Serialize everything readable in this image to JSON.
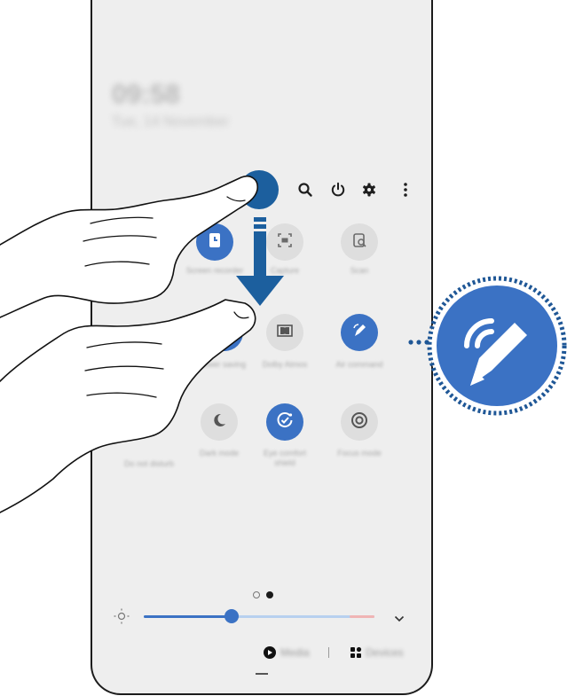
{
  "status": {
    "time": "09:58",
    "date": "Tue, 14 November"
  },
  "toolbar": {
    "icons": [
      "search-icon",
      "power-icon",
      "gear-icon",
      "more-vertical-icon"
    ]
  },
  "tiles": [
    {
      "name": "tile-screen-recorder",
      "icon": "screen-recorder-icon",
      "label": "Screen recorder",
      "state": "on"
    },
    {
      "name": "tile-video-capture",
      "icon": "capture-icon",
      "label": "Capture",
      "state": "off"
    },
    {
      "name": "tile-scan",
      "icon": "scan-icon",
      "label": "Scan",
      "state": "off"
    },
    {
      "name": "tile-power-saving",
      "icon": "power-saving-icon",
      "label": "Power saving",
      "state": "on"
    },
    {
      "name": "tile-dolby-atmos",
      "icon": "dolby-icon",
      "label": "Dolby Atmos",
      "state": "off"
    },
    {
      "name": "tile-air-command",
      "icon": "pen-icon",
      "label": "Air command",
      "state": "on"
    },
    {
      "name": "tile-dnd",
      "icon": "do-not-disturb-icon",
      "label": "Do not disturb",
      "state": "off"
    },
    {
      "name": "tile-dark-mode",
      "icon": "moon-icon",
      "label": "Dark mode",
      "state": "off"
    },
    {
      "name": "tile-eye-comfort",
      "icon": "check-clock-icon",
      "label": "Eye comfort shield",
      "state": "on"
    },
    {
      "name": "tile-focus-mode",
      "icon": "focus-icon",
      "label": "Focus mode",
      "state": "off"
    }
  ],
  "pager": {
    "pages": 2,
    "current": 2
  },
  "brightness": {
    "level": 0.38,
    "icon": "sun-icon"
  },
  "bottom_bar": {
    "media_label": "Media",
    "devices_label": "Devices"
  },
  "callout": {
    "icon": "air-command-pen-icon"
  },
  "colors": {
    "accent": "#3b72c4",
    "panel": "#eeeeee",
    "callout_border": "#1f5796",
    "tile_off": "#dedede"
  }
}
